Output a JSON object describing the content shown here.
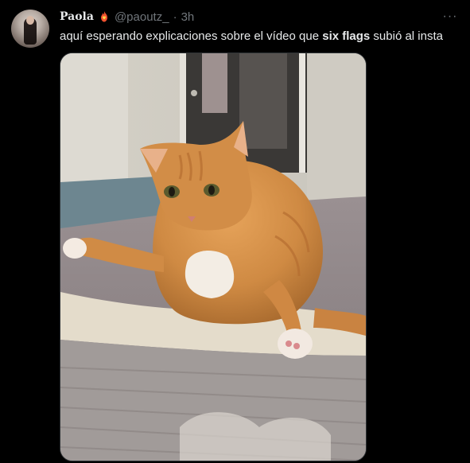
{
  "tweet": {
    "author_name": "Paola",
    "handle": "@paoutz_",
    "separator": "·",
    "time": "3h",
    "text_before": "aquí esperando explicaciones sobre el vídeo que ",
    "text_bold": "six flags",
    "text_after": " subió al insta",
    "more_label": "···",
    "badge_icon": "flame-heart-icon",
    "media_subject": "orange tabby cat sitting on a bed"
  },
  "colors": {
    "background": "#000000",
    "text": "#e7e9ea",
    "secondary": "#71767b",
    "border": "#2f3336"
  }
}
